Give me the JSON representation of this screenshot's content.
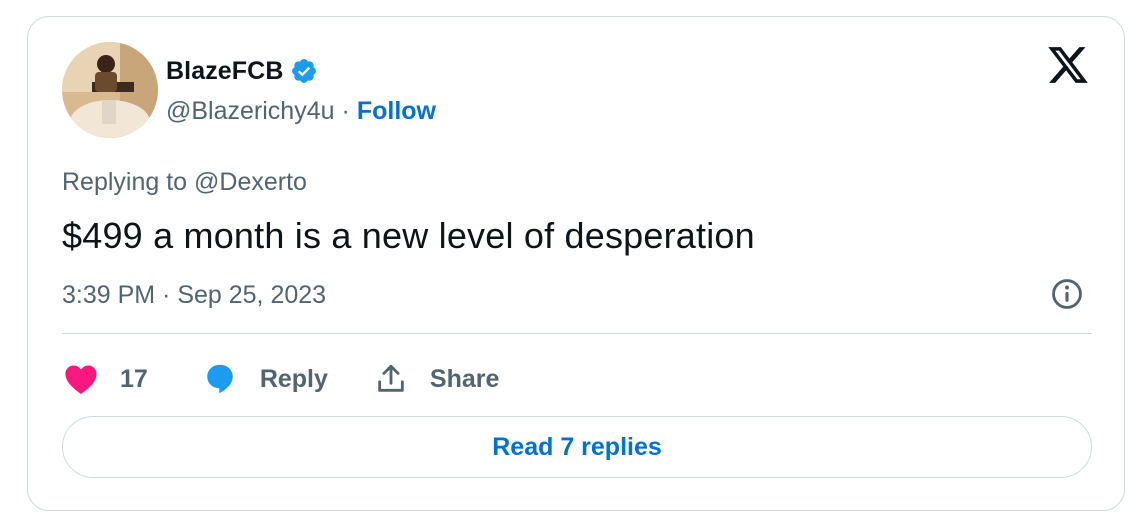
{
  "author": {
    "display_name": "BlazeFCB",
    "handle": "@Blazerichy4u",
    "separator": "·",
    "follow_label": "Follow",
    "verified": true
  },
  "tweet": {
    "replying_prefix": "Replying to",
    "replying_to": "@Dexerto",
    "text": "$499 a month is a new level of desperation",
    "timestamp": "3:39 PM · Sep 25, 2023"
  },
  "actions": {
    "like_count": "17",
    "reply_label": "Reply",
    "share_label": "Share"
  },
  "read_replies_label": "Read 7 replies",
  "colors": {
    "link_blue": "#006fd6",
    "verified_blue": "#1d9bf0",
    "like_pink": "#f91880",
    "secondary_text": "#536471",
    "border": "#cfd9de"
  },
  "icons": {
    "platform": "x-logo-icon",
    "verified": "verified-badge-icon",
    "info": "info-icon",
    "like": "heart-icon",
    "reply": "speech-bubble-icon",
    "share": "share-upload-icon"
  }
}
